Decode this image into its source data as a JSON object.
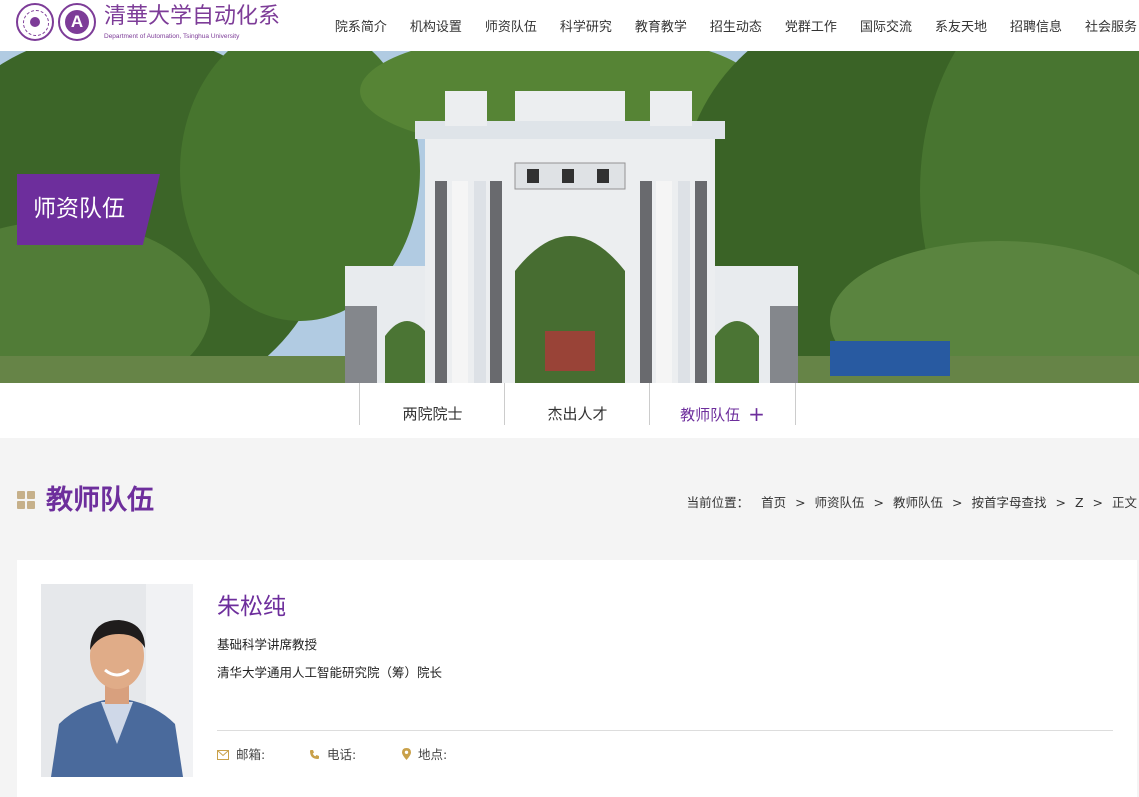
{
  "header": {
    "logo_text": "清華大学自动化系",
    "logo_subtitle": "Department of Automation, Tsinghua University",
    "nav": [
      "院系简介",
      "机构设置",
      "师资队伍",
      "科学研究",
      "教育教学",
      "招生动态",
      "党群工作",
      "国际交流",
      "系友天地",
      "招聘信息",
      "社会服务"
    ]
  },
  "banner": {
    "tag": "师资队伍"
  },
  "subnav": {
    "tabs": [
      "两院院士",
      "杰出人才",
      "教师队伍"
    ],
    "active_index": 2
  },
  "page": {
    "title": "教师队伍",
    "breadcrumb_label": "当前位置：",
    "breadcrumb": [
      "首页",
      "师资队伍",
      "教师队伍",
      "按首字母查找",
      "Z",
      "正文"
    ],
    "breadcrumb_separator": ">"
  },
  "profile": {
    "name": "朱松纯",
    "title1": "基础科学讲席教授",
    "title2": "清华大学通用人工智能研究院（筹）院长",
    "email_label": "邮箱:",
    "phone_label": "电话:",
    "location_label": "地点:"
  },
  "colors": {
    "brand_purple": "#6d2e9c",
    "accent_gold": "#c9a14a"
  }
}
